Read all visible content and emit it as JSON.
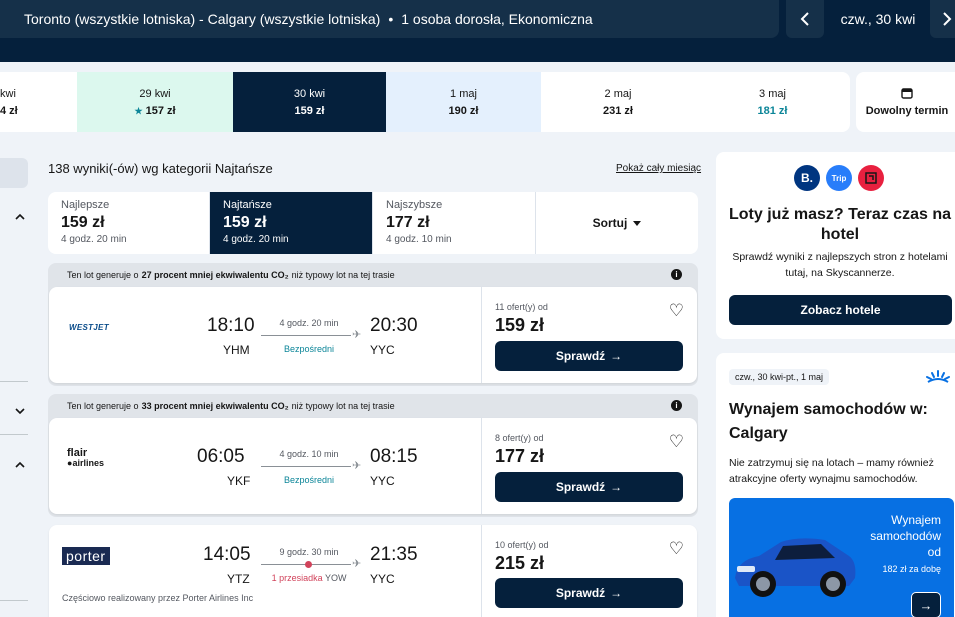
{
  "header": {
    "route": "Toronto (wszystkie lotniska) - Calgary (wszystkie lotniska)",
    "separator": "•",
    "passengers": "1 osoba dorosła, Ekonomiczna",
    "date": "czw., 30 kwi",
    "prev_icon": "chevron-left-icon",
    "next_icon": "chevron-right-icon"
  },
  "date_strip": [
    {
      "date": "kwi",
      "price": "4 zł",
      "state": "partial"
    },
    {
      "date": "29 kwi",
      "price": "157 zł",
      "state": "green",
      "star": "★"
    },
    {
      "date": "30 kwi",
      "price": "159 zł",
      "state": "selected"
    },
    {
      "date": "1 maj",
      "price": "190 zł",
      "state": "lightblue"
    },
    {
      "date": "2 maj",
      "price": "231 zł",
      "state": "normal"
    },
    {
      "date": "3 maj",
      "price": "181 zł",
      "state": "teal"
    }
  ],
  "any_date": {
    "label": "Dowolny termin",
    "icon": "calendar-icon"
  },
  "results": {
    "count_text": "138 wyniki(-ów) wg kategorii Najtańsze",
    "whole_month": "Pokaż cały miesiąc"
  },
  "sort_tabs": [
    {
      "title": "Najlepsze",
      "price": "159 zł",
      "duration": "4 godz. 20 min"
    },
    {
      "title": "Najtańsze",
      "price": "159 zł",
      "duration": "4 godz. 20 min"
    },
    {
      "title": "Najszybsze",
      "price": "177 zł",
      "duration": "4 godz. 10 min"
    }
  ],
  "sort_button": "Sortuj",
  "flights": [
    {
      "eco_pre": "Ten lot generuje o",
      "eco_bold": "27 procent mniej ekwiwalentu CO₂",
      "eco_post": "niż typowy lot na tej trasie",
      "airline": "WESTJET",
      "dep_time": "18:10",
      "dep_code": "YHM",
      "duration": "4 godz. 20 min",
      "stops": "Bezpośredni",
      "arr_time": "20:30",
      "arr_code": "YYC",
      "offers": "11 ofert(y) od",
      "price": "159 zł",
      "button": "Sprawdź"
    },
    {
      "eco_pre": "Ten lot generuje o",
      "eco_bold": "33 procent mniej ekwiwalentu CO₂",
      "eco_post": "niż typowy lot na tej trasie",
      "airline_line1": "flair",
      "airline_line2": "airlines",
      "dep_time": "06:05",
      "dep_code": "YKF",
      "duration": "4 godz. 10 min",
      "stops": "Bezpośredni",
      "arr_time": "08:15",
      "arr_code": "YYC",
      "offers": "8 ofert(y) od",
      "price": "177 zł",
      "button": "Sprawdź"
    },
    {
      "airline": "porter",
      "dep_time": "14:05",
      "dep_code": "YTZ",
      "duration": "9 godz. 30 min",
      "stops": "1 przesiadka",
      "stop_code": "YOW",
      "arr_time": "21:35",
      "arr_code": "YYC",
      "operated": "Częściowo realizowany przez Porter Airlines Inc",
      "offers": "10 ofert(y) od",
      "price": "215 zł",
      "button": "Sprawdź"
    }
  ],
  "hotels_panel": {
    "logos": [
      "B.",
      "Trip"
    ],
    "title": "Loty już masz? Teraz czas na hotel",
    "description": "Sprawdź wyniki z najlepszych stron z hotelami tutaj, na Skyscannerze.",
    "button": "Zobacz hotele"
  },
  "car_panel": {
    "dates": "czw., 30 kwi-pt., 1 maj",
    "title": "Wynajem samochodów w: Calgary",
    "description": "Nie zatrzymuj się na lotach – mamy również atrakcyjne oferty wynajmu samochodów.",
    "promo_line1": "Wynajem",
    "promo_line2": "samochodów",
    "promo_line3": "od",
    "promo_price": "182 zł za dobę"
  },
  "colors": {
    "navy": "#05203c",
    "teal": "#0b8598",
    "green_cell": "#dcf8ee",
    "blue_cell": "#e4f0fd",
    "stop_pink": "#d1435b",
    "promo_blue": "#0770e3"
  }
}
